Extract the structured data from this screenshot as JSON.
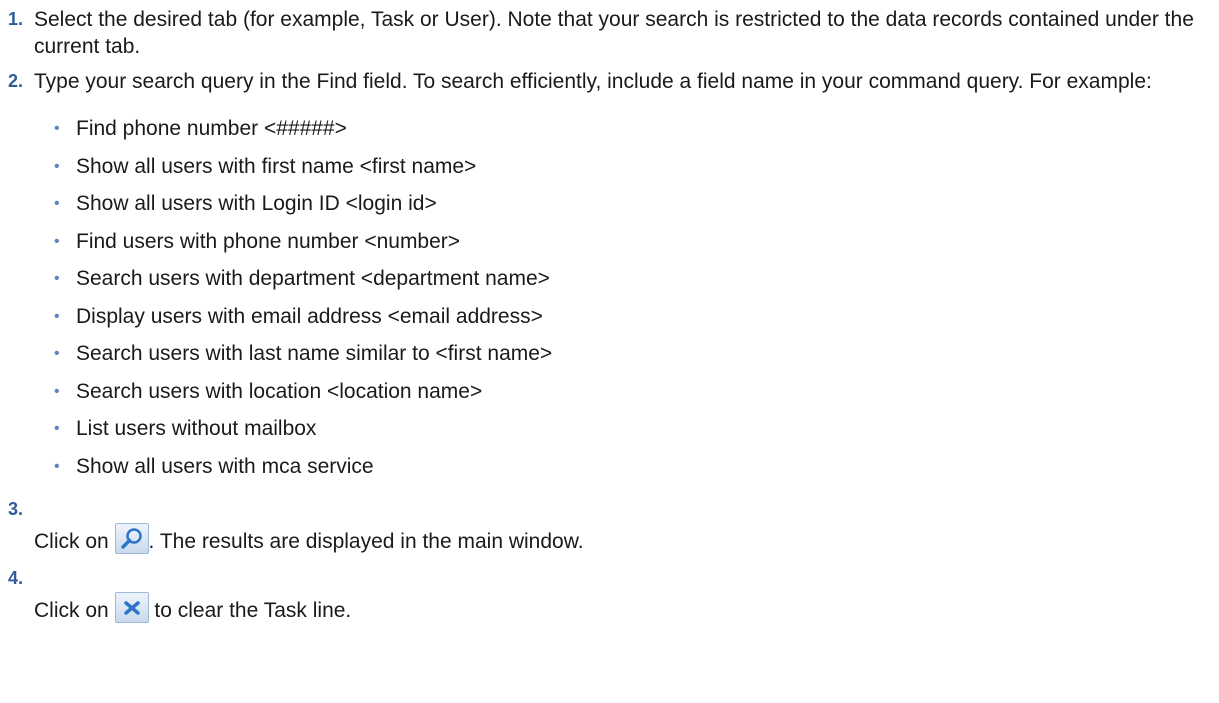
{
  "steps": [
    {
      "num": "1.",
      "text": "Select the desired tab (for example, Task or User). Note that your search is restricted to the data records contained under the current tab."
    },
    {
      "num": "2.",
      "text": "Type your search query in the Find field. To search efficiently, include a field name in your command query. For example:",
      "examples": [
        "Find phone number <#####>",
        "Show all users with first name <first name>",
        "Show all users with Login ID <login id>",
        "Find users with phone number <number>",
        "Search users with department <department name>",
        "Display users with email address <email address>",
        "Search users with last name similar to <first name>",
        "Search users with location <location name>",
        "List users without mailbox",
        "Show all users with mca service"
      ]
    },
    {
      "num": "3.",
      "text_before": "Click on",
      "icon": "search-icon",
      "text_after": ". The results are displayed in the main window."
    },
    {
      "num": "4.",
      "text_before": "Click on",
      "icon": "close-icon",
      "text_after": " to clear the Task line."
    }
  ],
  "bullet": "•",
  "colors": {
    "step_number": "#2e5b9a",
    "bullet": "#5a86c0",
    "text": "#1a1a1a",
    "icon_blue": "#2d73c8"
  }
}
